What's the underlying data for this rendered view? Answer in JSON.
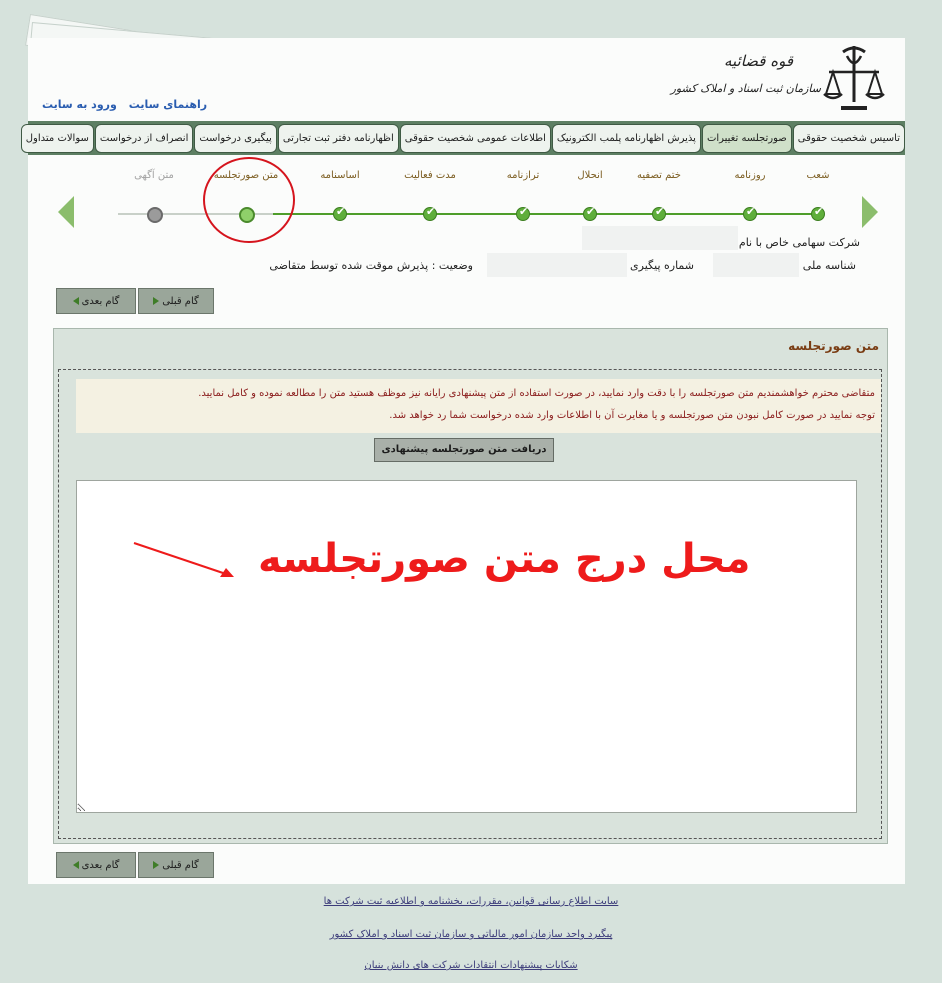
{
  "header": {
    "org_line1": "قوه قضائیه",
    "org_line2": "سازمان ثبت اسناد و املاک کشور",
    "login_link": "ورود به سایت",
    "guide_link": "راهنمای سایت"
  },
  "nav": {
    "tabs": [
      {
        "label": "تاسیس شخصیت حقوقی"
      },
      {
        "label": "صورتجلسه تغییرات"
      },
      {
        "label": "پذیرش اظهارنامه پلمب الکترونیک"
      },
      {
        "label": "اطلاعات عمومی شخصیت حقوقی"
      },
      {
        "label": "اظهارنامه دفتر ثبت تجارتی"
      },
      {
        "label": "پیگیری درخواست"
      },
      {
        "label": "انصراف از درخواست"
      },
      {
        "label": "سوالات متداول"
      }
    ]
  },
  "steps": [
    {
      "label": "شعب",
      "state": "done"
    },
    {
      "label": "روزنامه",
      "state": "done"
    },
    {
      "label": "ختم تصفیه",
      "state": "done"
    },
    {
      "label": "انحلال",
      "state": "done"
    },
    {
      "label": "ترازنامه",
      "state": "done"
    },
    {
      "label": "مدت فعالیت",
      "state": "done"
    },
    {
      "label": "اساسنامه",
      "state": "done"
    },
    {
      "label": "متن صورتجلسه",
      "state": "current"
    },
    {
      "label": "متن آگهی",
      "state": "future"
    }
  ],
  "info": {
    "company_label": "شرکت سهامی خاص با نام",
    "national_id_label": "شناسه ملی :",
    "tracking_label": "شماره پیگیری :",
    "status": "وضعیت : پذیرش موقت شده توسط متقاضی"
  },
  "buttons": {
    "next": "گام بعدی",
    "prev": "گام قبلی",
    "fetch": "دریافت متن صورتجلسه پیشنهادی"
  },
  "panel": {
    "title": "متن صورتجلسه",
    "notice_line1": "متقاضی محترم خواهشمندیم متن صورتجلسه را با دقت وارد نمایید، در صورت استفاده از متن پیشنهادی رایانه نیز موظف هستید متن را مطالعه نموده و کامل نمایید.",
    "notice_line2": "توجه نمایید در صورت کامل نبودن متن صورتجلسه و یا مغایرت آن با اطلاعات وارد شده درخواست شما رد خواهد شد."
  },
  "annotation": {
    "text": "محل درج متن صورتجلسه"
  },
  "footer": {
    "links": [
      "سایت اطلاع رسانی قوانین، مقررات، بخشنامه و اطلاعیه ثبت شرکت ها",
      "پیگیرد واحد سازمان امور مالیاتی و سازمان ثبت اسناد و املاک کشور",
      "شکایات پیشنهادات انتقادات شرکت های دانش بنیان"
    ]
  },
  "colors": {
    "nav_bg": "#5d7f63",
    "step_done": "#4e9d2a",
    "highlight_red": "#ee1b1b",
    "panel_title": "#7a3d14"
  }
}
